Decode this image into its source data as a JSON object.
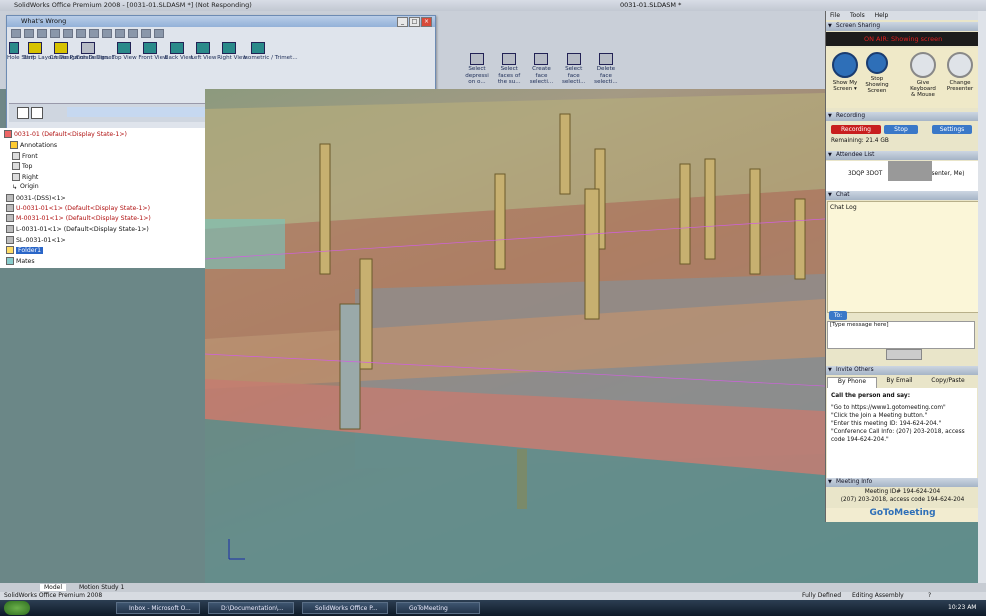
{
  "titlebar": {
    "app": "SolidWorks Office Premium 2008 - [0031-01.SLDASM *] (Not Responding)",
    "doc_title": "0031-01.SLDASM *"
  },
  "whats_wrong": {
    "title": "What's Wrong"
  },
  "command_buttons": [
    {
      "label": "Hole Start"
    },
    {
      "label": "Strip Layout Design"
    },
    {
      "label": "Create Punch Design..."
    },
    {
      "label": "Create Dieset"
    },
    {
      "label": "Top View"
    },
    {
      "label": "Front View"
    },
    {
      "label": "Back View"
    },
    {
      "label": "Left View"
    },
    {
      "label": "Right View"
    },
    {
      "label": "Isometric / Trimet..."
    }
  ],
  "command_buttons2": [
    {
      "label": "Select depressi on o..."
    },
    {
      "label": "Select faces of the su..."
    },
    {
      "label": "Create face selecti..."
    },
    {
      "label": "Select face selecti..."
    },
    {
      "label": "Delete face selecti..."
    }
  ],
  "feature_tree": {
    "items": [
      {
        "label": "0031-01 (Default<Display State-1>)",
        "cls": "red"
      },
      {
        "label": "Annotations",
        "cls": ""
      },
      {
        "label": "Front",
        "cls": ""
      },
      {
        "label": "Top",
        "cls": ""
      },
      {
        "label": "Right",
        "cls": ""
      },
      {
        "label": "Origin",
        "cls": ""
      },
      {
        "label": "0031-(DSS)<1>",
        "cls": ""
      },
      {
        "label": "U-0031-01<1> (Default<Display State-1>)",
        "cls": "red"
      },
      {
        "label": "M-0031-01<1> (Default<Display State-1>)",
        "cls": "red"
      },
      {
        "label": "L-0031-01<1> (Default<Display State-1>)",
        "cls": ""
      },
      {
        "label": "SL-0031-01<1>",
        "cls": ""
      },
      {
        "label": "Folder1",
        "cls": "sel"
      },
      {
        "label": "Mates",
        "cls": ""
      }
    ]
  },
  "goto": {
    "menu": {
      "file": "File",
      "tools": "Tools",
      "help": "Help"
    },
    "screen_sharing": "Screen Sharing",
    "on_air": "ON AIR: Showing screen",
    "ss_buttons": [
      {
        "label": "Show My Screen ▾"
      },
      {
        "label": "Stop Showing Screen"
      },
      {
        "label": "Give Keyboard & Mouse"
      },
      {
        "label": "Change Presenter"
      }
    ],
    "recording": "Recording",
    "rec_btn": "Recording",
    "stop_btn": "Stop",
    "settings_btn": "Settings",
    "remaining": "Remaining: 21.4 GB",
    "attendee_list": "Attendee List",
    "attendee": "3DQP 3DOT",
    "attendee_role": "(Organizer, Presenter, Me)",
    "chat": "Chat",
    "chat_log": "Chat Log",
    "to_label": "To:",
    "message_placeholder": "[Type message here]",
    "invite": "Invite Others",
    "tabs": [
      "By Phone",
      "By Email",
      "Copy/Paste"
    ],
    "call_heading": "Call the person and say:",
    "instructions": [
      "\"Go to https://www1.gotomeeting.com\"",
      "\"Click the Join a Meeting button.\"",
      "\"Enter this meeting ID: 194-624-204.\"",
      "\"Conference Call Info: (207) 203-2018, access code 194-624-204.\""
    ],
    "meeting_info": "Meeting Info",
    "meeting_id_line": "Meeting ID# 194-624-204",
    "conf_line": "(207) 203-2018, access code 194-624-204",
    "logo": "GoToMeeting"
  },
  "bottom_tabs": [
    "Model",
    "Motion Study 1"
  ],
  "status": {
    "left": "SolidWorks Office Premium 2008",
    "defined": "Fully Defined",
    "mode": "Editing Assembly",
    "help": "?"
  },
  "taskbar": {
    "start": "Start",
    "tasks": [
      "Inbox - Microsoft O...",
      "D:\\Documentation\\...",
      "SolidWorks Office P...",
      "GoToMeeting"
    ],
    "clock": "10:23 AM"
  },
  "colors": {
    "accent": "#2a66c8",
    "record_red": "#c81e1e",
    "onair_red": "#e02020"
  }
}
